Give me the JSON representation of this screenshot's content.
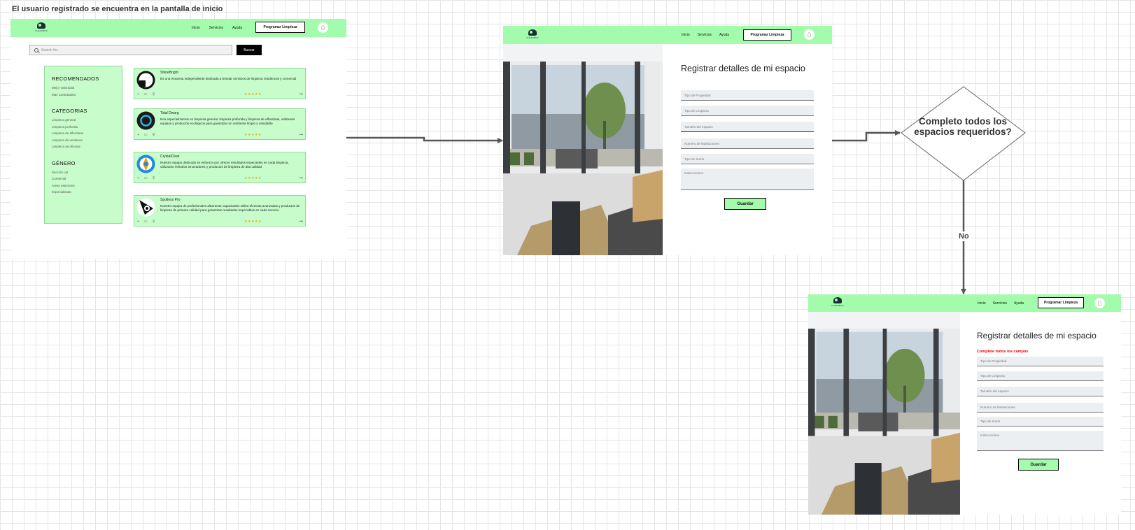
{
  "canvas": {
    "title": "El usuario registrado se encuentra en la pantalla de inicio"
  },
  "navbar": {
    "logo_text": "CLEANBOX",
    "links": [
      "Inicio",
      "Servicios",
      "Ayuda"
    ],
    "cta": "Programar Limpieza"
  },
  "home": {
    "search_placeholder": "Search for...",
    "search_button": "Buscar",
    "sidebar": [
      {
        "heading": "RECOMENDADOS",
        "items": [
          "Mejor Valorados",
          "Mas Contratados"
        ]
      },
      {
        "heading": "CATEGORIAS",
        "items": [
          "Limpieza general",
          "Limpieza profunda",
          "Limpieza de alfombras",
          "Limpieza de ventanas",
          "Limpieza de oficinas"
        ]
      },
      {
        "heading": "GÉNERO",
        "items": [
          "Sección cal",
          "Comercial",
          "Areas exteriores",
          "Especializada"
        ]
      }
    ],
    "providers": [
      {
        "name": "ShineBright",
        "description": "Es una empresa independiente dedicada a brindar servicios de limpieza residencial y comercial",
        "stars": "★★★★★"
      },
      {
        "name": "Tidal Dwarg",
        "description": "Nos especializamos en limpieza general, limpieza profunda y limpieza de alfombras, utilizando equipos y productos ecológicos para garantizar un ambiente limpio y saludable",
        "stars": "★★★★★"
      },
      {
        "name": "CrystalClear",
        "description": "Nuestro equipo dedicado se esfuerza por ofrecer resultados impecables en cada limpieza, utilizando métodos innovadores y productos de limpieza de alta calidad",
        "stars": "★★★★★"
      },
      {
        "name": "Spotless Pro",
        "description": "Nuestro equipo de profesionales altamente capacitados utiliza técnicas avanzadas y productos de limpieza de primera calidad para garantizar resultados impecables en cada servicio",
        "stars": "★★★★★"
      }
    ],
    "card_actions": [
      "+",
      "▭",
      "⚲"
    ],
    "card_more": "•••"
  },
  "register_form": {
    "title": "Registrar detalles de mi espacio",
    "fields": [
      "Tipo de Propiedad",
      "Tipo de Limpieza",
      "Tamaño del espacio",
      "Numero de habitaciones",
      "Tipo de Suelo",
      "Instrucciones"
    ],
    "save_button": "Guardar"
  },
  "register_form_error": {
    "title": "Registrar detalles de mi espacio",
    "error": "Complete todos los campos",
    "fields": [
      "Tipo de Propiedad",
      "Tipo de Limpieza",
      "Tamaño del espacio",
      "Numero de habitaciones",
      "Tipo de Suelo",
      "Instrucciones"
    ],
    "save_button": "Guardar"
  },
  "decision": {
    "text": "Completo todos los espacios requeridos?",
    "no_label": "No"
  },
  "colors": {
    "nav_green": "#a3fcab",
    "card_green": "#c7fccb",
    "error_red": "#e00000",
    "connector": "#555555"
  }
}
